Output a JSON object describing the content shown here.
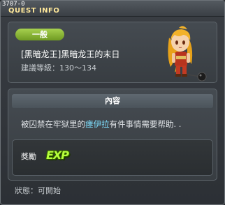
{
  "window": {
    "quest_id": "3707-0",
    "title": "QUEST INFO"
  },
  "quest": {
    "category": "一般",
    "name": "[黑暗龙王]黑暗龙王的末日",
    "level_label": "建議等級：",
    "level_range": "130～134"
  },
  "content": {
    "header": "內容",
    "text_before": "被囚禁在牢狱里的",
    "highlight_name": "瘗伊拉",
    "text_after": "有件事情需要帮助. .",
    "highlight_color": "#7fe0ff"
  },
  "reward": {
    "label": "獎勵",
    "icon": "exp-icon",
    "icon_text": "EXP"
  },
  "status": {
    "label": "狀態：",
    "value": "可開始"
  },
  "colors": {
    "title": "#ffe89a",
    "badge": "#8ab83a",
    "exp": "#b6ff3c"
  }
}
